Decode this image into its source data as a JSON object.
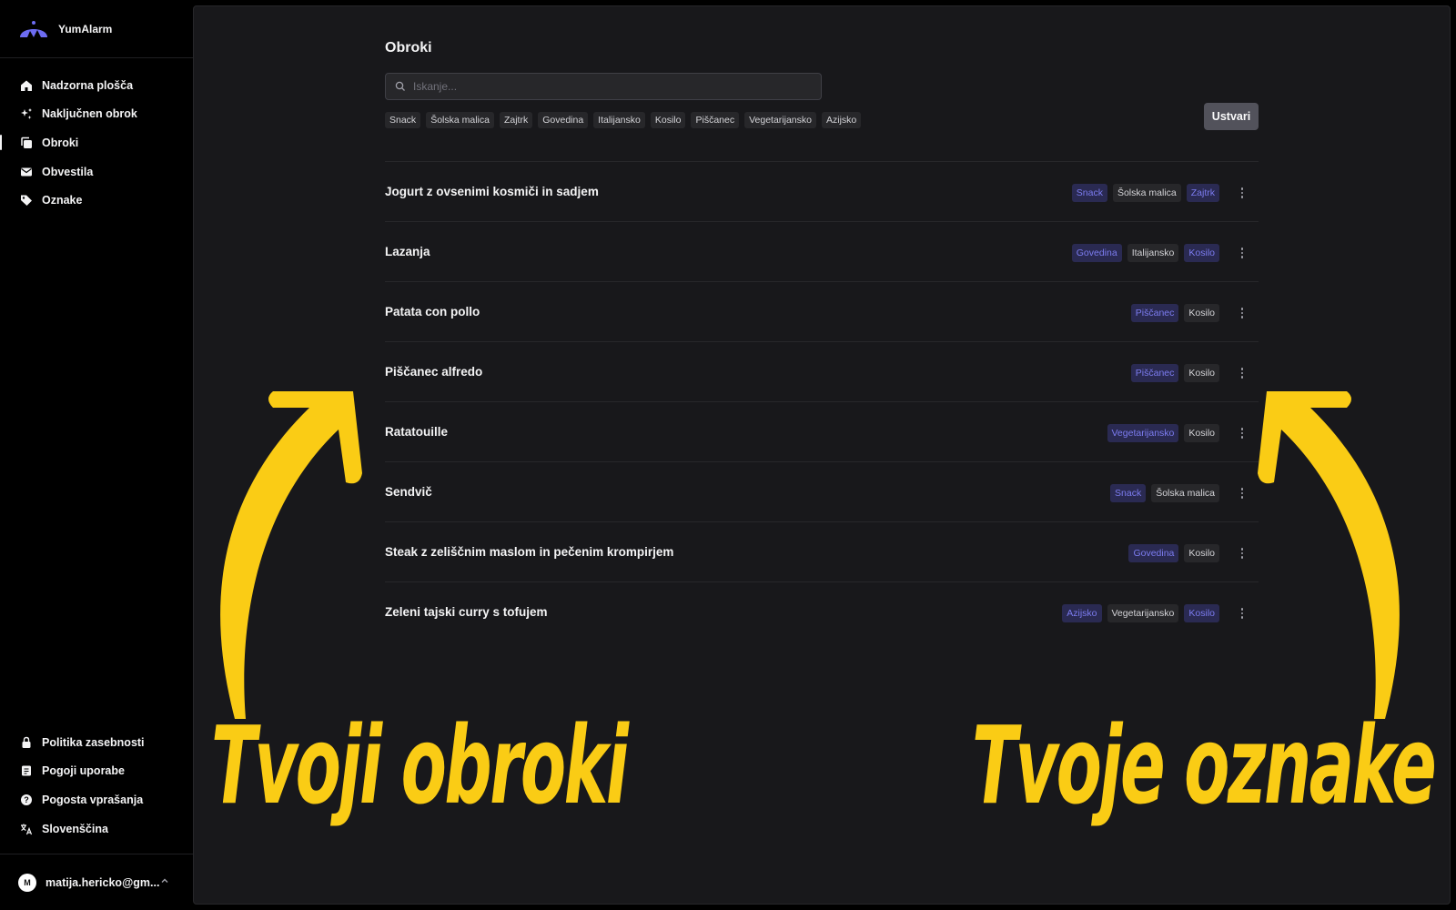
{
  "app": {
    "name": "YumAlarm"
  },
  "sidebar": {
    "items": [
      {
        "label": "Nadzorna plošča",
        "icon": "home-icon"
      },
      {
        "label": "Naključnen obrok",
        "icon": "sparkles-icon"
      },
      {
        "label": "Obroki",
        "icon": "stack-icon",
        "active": true
      },
      {
        "label": "Obvestila",
        "icon": "mail-icon"
      },
      {
        "label": "Oznake",
        "icon": "tag-icon"
      }
    ],
    "bottom_items": [
      {
        "label": "Politika zasebnosti",
        "icon": "lock-icon"
      },
      {
        "label": "Pogoji uporabe",
        "icon": "document-icon"
      },
      {
        "label": "Pogosta vprašanja",
        "icon": "question-icon"
      },
      {
        "label": "Slovenščina",
        "icon": "translate-icon"
      }
    ],
    "user": {
      "initial": "M",
      "email": "matija.hericko@gm..."
    }
  },
  "main": {
    "title": "Obroki",
    "search": {
      "placeholder": "Iskanje...",
      "value": ""
    },
    "filters": [
      "Snack",
      "Šolska malica",
      "Zajtrk",
      "Govedina",
      "Italijansko",
      "Kosilo",
      "Piščanec",
      "Vegetarijansko",
      "Azijsko"
    ],
    "create_label": "Ustvari",
    "meals": [
      {
        "name": "Jogurt z ovsenimi kosmiči in sadjem",
        "tags": [
          {
            "label": "Snack",
            "hl": true
          },
          {
            "label": "Šolska malica",
            "hl": false
          },
          {
            "label": "Zajtrk",
            "hl": true
          }
        ]
      },
      {
        "name": "Lazanja",
        "tags": [
          {
            "label": "Govedina",
            "hl": true
          },
          {
            "label": "Italijansko",
            "hl": false
          },
          {
            "label": "Kosilo",
            "hl": true
          }
        ]
      },
      {
        "name": "Patata con pollo",
        "tags": [
          {
            "label": "Piščanec",
            "hl": true
          },
          {
            "label": "Kosilo",
            "hl": false
          }
        ]
      },
      {
        "name": "Piščanec alfredo",
        "tags": [
          {
            "label": "Piščanec",
            "hl": true
          },
          {
            "label": "Kosilo",
            "hl": false
          }
        ]
      },
      {
        "name": "Ratatouille",
        "tags": [
          {
            "label": "Vegetarijansko",
            "hl": true
          },
          {
            "label": "Kosilo",
            "hl": false
          }
        ]
      },
      {
        "name": "Sendvič",
        "tags": [
          {
            "label": "Snack",
            "hl": true
          },
          {
            "label": "Šolska malica",
            "hl": false
          }
        ]
      },
      {
        "name": "Steak z zeliščnim maslom in pečenim krompirjem",
        "tags": [
          {
            "label": "Govedina",
            "hl": true
          },
          {
            "label": "Kosilo",
            "hl": false
          }
        ]
      },
      {
        "name": "Zeleni tajski curry s tofujem",
        "tags": [
          {
            "label": "Azijsko",
            "hl": true
          },
          {
            "label": "Vegetarijansko",
            "hl": false
          },
          {
            "label": "Kosilo",
            "hl": true
          }
        ]
      }
    ]
  },
  "annotations": {
    "left_caption": "Tvoji obroki",
    "right_caption": "Tvoje oznake",
    "color": "#facc15"
  },
  "colors": {
    "accent": "#6d6cf2",
    "highlight_tag_bg": "#2a2a52",
    "annotation": "#facc15"
  }
}
